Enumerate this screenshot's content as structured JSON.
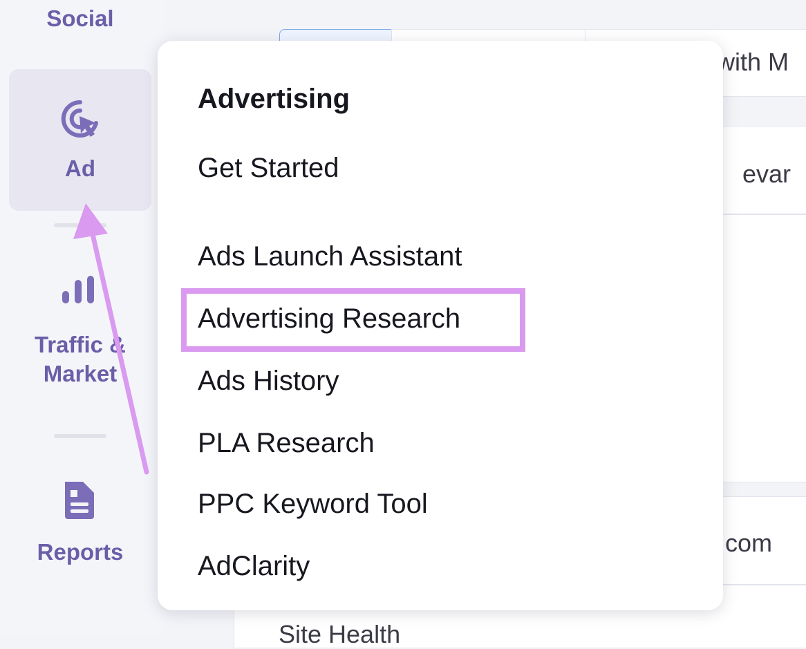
{
  "sidebar": {
    "items": [
      {
        "label": "Social",
        "icon": "social-icon"
      },
      {
        "label": "Ad",
        "icon": "ad-cursor-target-icon"
      },
      {
        "label": "Traffic & Market",
        "icon": "bar-chart-icon"
      },
      {
        "label": "Reports",
        "icon": "report-document-icon"
      }
    ]
  },
  "background": {
    "header_fragment": "with M",
    "row1_fragment": "evar",
    "row2_fragment": "com",
    "bottom_fragment": "Site Health"
  },
  "menu": {
    "title": "Advertising",
    "items": [
      {
        "label": "Get Started"
      },
      {
        "label": "Ads Launch Assistant"
      },
      {
        "label": "Advertising Research",
        "highlighted": true
      },
      {
        "label": "Ads History"
      },
      {
        "label": "PLA Research"
      },
      {
        "label": "PPC Keyword Tool"
      },
      {
        "label": "AdClarity"
      }
    ]
  },
  "colors": {
    "accent": "#6b5ea8",
    "annotation": "#d99af0"
  }
}
